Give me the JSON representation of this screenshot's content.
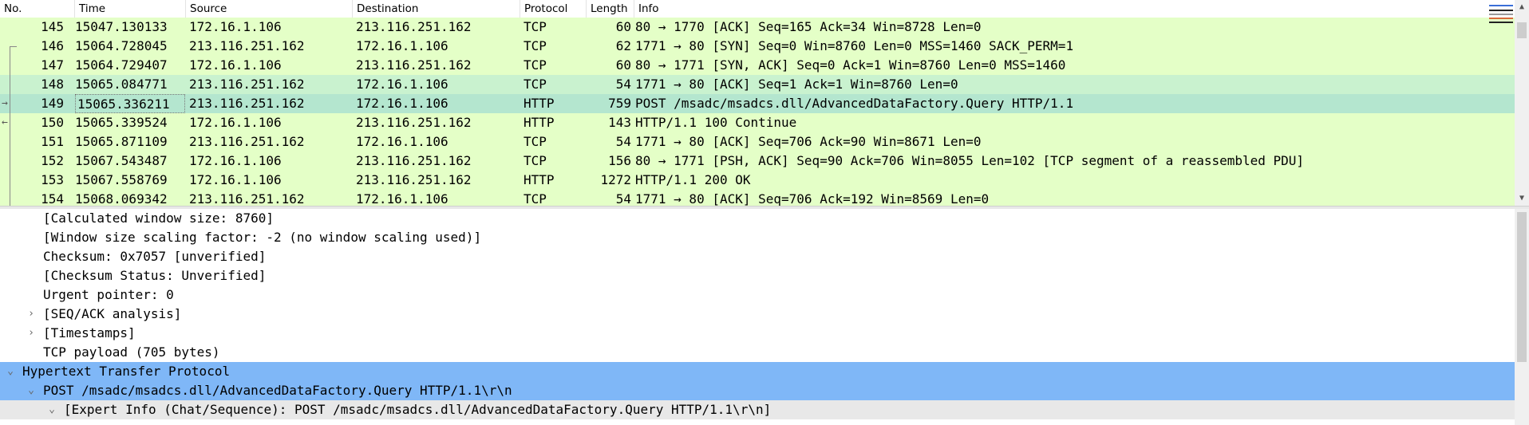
{
  "packet_list": {
    "columns": [
      "No.",
      "Time",
      "Source",
      "Destination",
      "Protocol",
      "Length",
      "Info"
    ],
    "rows": [
      {
        "no": "145",
        "time": "15047.130133",
        "src": "172.16.1.106",
        "dst": "213.116.251.162",
        "proto": "TCP",
        "len": "60",
        "info": "80 → 1770 [ACK] Seq=165 Ack=34 Win=8728 Len=0"
      },
      {
        "no": "146",
        "time": "15064.728045",
        "src": "213.116.251.162",
        "dst": "172.16.1.106",
        "proto": "TCP",
        "len": "62",
        "info": "1771 → 80 [SYN] Seq=0 Win=8760 Len=0 MSS=1460 SACK_PERM=1"
      },
      {
        "no": "147",
        "time": "15064.729407",
        "src": "172.16.1.106",
        "dst": "213.116.251.162",
        "proto": "TCP",
        "len": "60",
        "info": "80 → 1771 [SYN, ACK] Seq=0 Ack=1 Win=8760 Len=0 MSS=1460"
      },
      {
        "no": "148",
        "time": "15065.084771",
        "src": "213.116.251.162",
        "dst": "172.16.1.106",
        "proto": "TCP",
        "len": "54",
        "info": "1771 → 80 [ACK] Seq=1 Ack=1 Win=8760 Len=0"
      },
      {
        "no": "149",
        "time": "15065.336211",
        "src": "213.116.251.162",
        "dst": "172.16.1.106",
        "proto": "HTTP",
        "len": "759",
        "info": "POST /msadc/msadcs.dll/AdvancedDataFactory.Query HTTP/1.1"
      },
      {
        "no": "150",
        "time": "15065.339524",
        "src": "172.16.1.106",
        "dst": "213.116.251.162",
        "proto": "HTTP",
        "len": "143",
        "info": "HTTP/1.1 100 Continue"
      },
      {
        "no": "151",
        "time": "15065.871109",
        "src": "213.116.251.162",
        "dst": "172.16.1.106",
        "proto": "TCP",
        "len": "54",
        "info": "1771 → 80 [ACK] Seq=706 Ack=90 Win=8671 Len=0"
      },
      {
        "no": "152",
        "time": "15067.543487",
        "src": "172.16.1.106",
        "dst": "213.116.251.162",
        "proto": "TCP",
        "len": "156",
        "info": "80 → 1771 [PSH, ACK] Seq=90 Ack=706 Win=8055 Len=102 [TCP segment of a reassembled PDU]"
      },
      {
        "no": "153",
        "time": "15067.558769",
        "src": "172.16.1.106",
        "dst": "213.116.251.162",
        "proto": "HTTP",
        "len": "1272",
        "info": "HTTP/1.1 200 OK"
      },
      {
        "no": "154",
        "time": "15068.069342",
        "src": "213.116.251.162",
        "dst": "172.16.1.106",
        "proto": "TCP",
        "len": "54",
        "info": "1771 → 80 [ACK] Seq=706 Ack=192 Win=8569 Len=0"
      }
    ],
    "colors": {
      "tcp_row": "#e4ffc7",
      "alt_row": "#c9f2cf",
      "selected_row": "#b4e6cf"
    }
  },
  "detail": {
    "lines": [
      {
        "text": "[Calculated window size: 8760]"
      },
      {
        "text": "[Window size scaling factor: -2 (no window scaling used)]"
      },
      {
        "text": "Checksum: 0x7057 [unverified]"
      },
      {
        "text": "[Checksum Status: Unverified]"
      },
      {
        "text": "Urgent pointer: 0"
      },
      {
        "text": "[SEQ/ACK analysis]",
        "toggle": "›"
      },
      {
        "text": "[Timestamps]",
        "toggle": "›"
      },
      {
        "text": "TCP payload (705 bytes)"
      },
      {
        "text": "Hypertext Transfer Protocol",
        "toggle": "⌄"
      },
      {
        "text": "POST /msadc/msadcs.dll/AdvancedDataFactory.Query HTTP/1.1\\r\\n",
        "toggle": "⌄"
      },
      {
        "text": "[Expert Info (Chat/Sequence): POST /msadc/msadcs.dll/AdvancedDataFactory.Query HTTP/1.1\\r\\n]",
        "toggle": "⌄"
      }
    ],
    "colors": {
      "highlight": "#7fb7f7"
    }
  },
  "icons": {
    "scroll_up": "▲",
    "scroll_down": "▼",
    "related_arrow_right": "→",
    "related_arrow_left": "←"
  }
}
